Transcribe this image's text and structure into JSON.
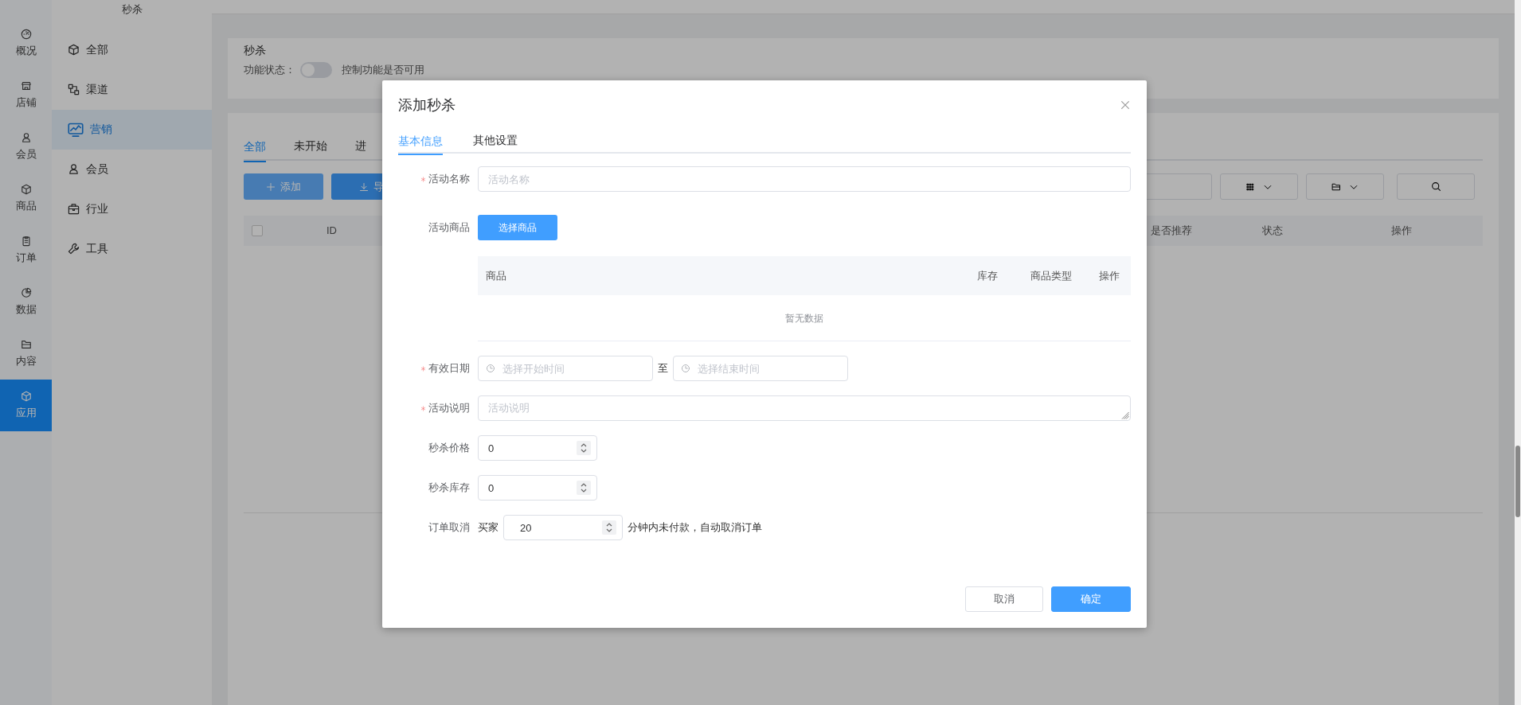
{
  "rail": [
    {
      "label": "概况",
      "selected": false
    },
    {
      "label": "店铺",
      "selected": false
    },
    {
      "label": "会员",
      "selected": false
    },
    {
      "label": "商品",
      "selected": false
    },
    {
      "label": "订单",
      "selected": false
    },
    {
      "label": "数据",
      "selected": false
    },
    {
      "label": "内容",
      "selected": false
    },
    {
      "label": "应用",
      "selected": true
    }
  ],
  "submenu": {
    "title": "秒杀",
    "items": [
      {
        "label": "全部",
        "selected": false
      },
      {
        "label": "渠道",
        "selected": false
      },
      {
        "label": "营销",
        "selected": true
      },
      {
        "label": "会员",
        "selected": false
      },
      {
        "label": "行业",
        "selected": false
      },
      {
        "label": "工具",
        "selected": false
      }
    ]
  },
  "feature_card": {
    "title": "秒杀",
    "status_label": "功能状态：",
    "toggle_on": false,
    "hint": "控制功能是否可用"
  },
  "list_tabs": [
    {
      "label": "全部",
      "selected": true
    },
    {
      "label": "未开始",
      "selected": false
    },
    {
      "label": "进",
      "selected": false
    }
  ],
  "toolbar": {
    "buttons": [
      {
        "label": "添加",
        "kind": "add"
      },
      {
        "label": "导",
        "kind": "export"
      }
    ]
  },
  "table": {
    "select_all_checked": false,
    "columns": [
      "ID",
      "是否推荐",
      "状态",
      "操作"
    ]
  },
  "modal": {
    "title": "添加秒杀",
    "tabs": [
      {
        "label": "基本信息",
        "selected": true
      },
      {
        "label": "其他设置",
        "selected": false
      }
    ],
    "fields": [
      {
        "kind": "text",
        "label": "活动名称",
        "required": true,
        "placeholder": "活动名称"
      },
      {
        "kind": "goods",
        "label": "活动商品",
        "required": false,
        "button": "选择商品",
        "columns": [
          "商品",
          "库存",
          "商品类型",
          "操作"
        ],
        "empty_text": "暂无数据"
      },
      {
        "kind": "daterange",
        "label": "有效日期",
        "required": true,
        "start_placeholder": "选择开始时间",
        "separator": "至",
        "end_placeholder": "选择结束时间"
      },
      {
        "kind": "textarea",
        "label": "活动说明",
        "required": true,
        "placeholder": "活动说明"
      },
      {
        "kind": "number",
        "label": "秒杀价格",
        "required": false,
        "value": "0"
      },
      {
        "kind": "number",
        "label": "秒杀库存",
        "required": false,
        "value": "0"
      },
      {
        "kind": "cancel",
        "label": "订单取消",
        "required": false,
        "prefix": "买家",
        "value": "20",
        "suffix": "分钟内未付款，自动取消订单"
      }
    ],
    "buttons": [
      {
        "label": "取消",
        "kind": "default"
      },
      {
        "label": "确定",
        "kind": "primary"
      }
    ]
  }
}
